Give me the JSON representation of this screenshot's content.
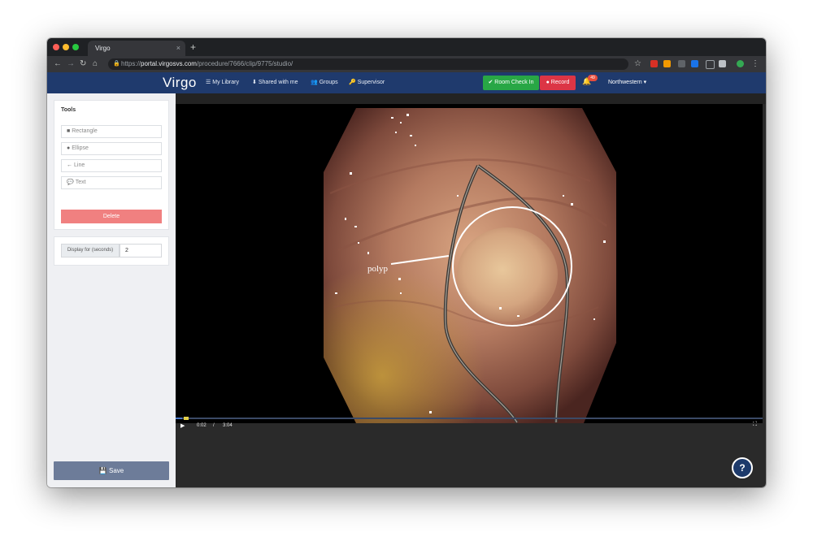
{
  "browser": {
    "tab_title": "Virgo",
    "tab_close": "×",
    "new_tab": "+",
    "url_prefix": "https://",
    "url_host": "portal.virgosvs.com",
    "url_path": "/procedure/7666/clip/9775/studio/"
  },
  "navbar": {
    "logo": "Virgo",
    "links": [
      {
        "label": "My Library"
      },
      {
        "label": "Shared with me"
      },
      {
        "label": "Groups"
      },
      {
        "label": "Supervisor"
      }
    ],
    "room_check_in": "Room Check In",
    "record": "Record",
    "notification_count": "49",
    "user_menu": "Northwestern"
  },
  "tools_panel": {
    "title": "Tools",
    "tools": [
      {
        "label": "Rectangle",
        "icon": "square-icon"
      },
      {
        "label": "Ellipse",
        "icon": "circle-icon"
      },
      {
        "label": "Line",
        "icon": "arrow-left-icon"
      },
      {
        "label": "Text",
        "icon": "comment-icon"
      }
    ],
    "delete_label": "Delete"
  },
  "display": {
    "label": "Display for (seconds)",
    "value": "2"
  },
  "save_label": "Save",
  "video": {
    "annotation_text": "polyp",
    "current_time": "0:02",
    "separator": "/",
    "duration": "3:04",
    "progress_fraction": 0.0109
  },
  "help_label": "?",
  "colors": {
    "navbar": "#1f3a6d",
    "room_check_in": "#28a745",
    "record": "#dc3545",
    "delete": "#f08080",
    "save": "#6d7c99"
  }
}
